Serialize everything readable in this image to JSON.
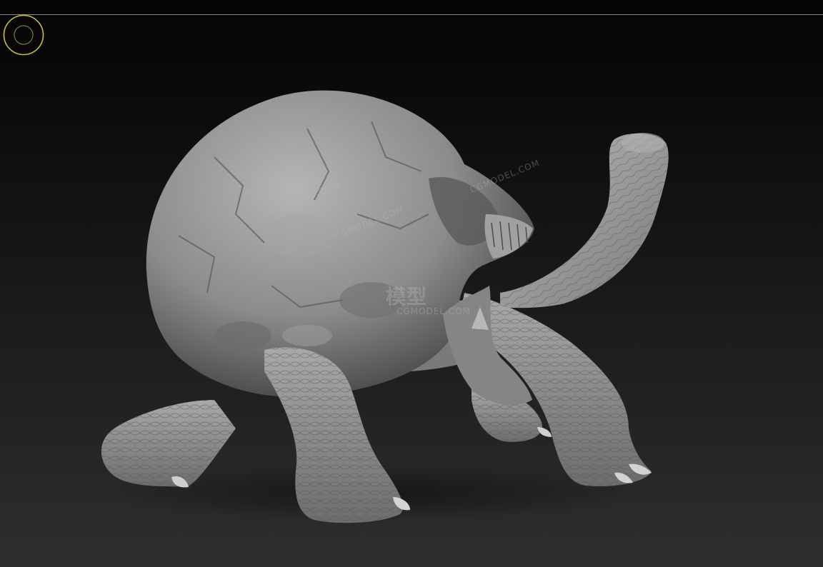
{
  "viewport": {
    "background_top": "#050505",
    "background_bottom": "#2e2e2e",
    "top_line_color": "#8a8a8a"
  },
  "gizmo": {
    "icon": "orbit-gizmo-icon",
    "color": "#c9bf3a"
  },
  "model": {
    "subject": "sculpted skull-shelled tortoise",
    "material_color": "#8e8e8e"
  },
  "watermark": {
    "logo_text": "模型",
    "site_text": "CGMODEL.COM"
  }
}
